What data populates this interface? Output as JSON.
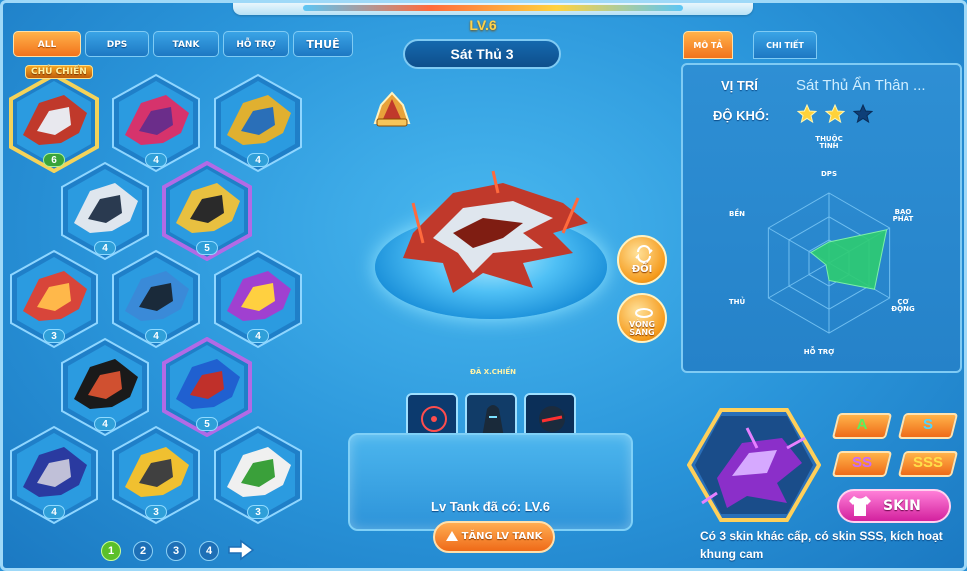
{
  "tabs": {
    "all": "ALL",
    "dps": "DPS",
    "tank": "TANK",
    "ho_tro": "HỖ TRỢ",
    "thue": "THUÊ"
  },
  "roster": {
    "main_tag": "CHỦ CHIẾN",
    "levels": [
      "6",
      "4",
      "4",
      "4",
      "5",
      "3",
      "4",
      "4",
      "4",
      "5",
      "4",
      "3",
      "3"
    ],
    "pages": [
      "1",
      "2",
      "3",
      "4"
    ]
  },
  "hero": {
    "level": "LV.6",
    "name": "Sát Thủ 3",
    "swap_label": "ĐỔI",
    "ring_label": "VÒNG\nSÁNG",
    "equipped_label": "ĐÃ X.CHIẾN",
    "tank_level_text": "Lv Tank đã có: LV.6",
    "upgrade_label": "TĂNG LV TANK"
  },
  "right_tabs": {
    "desc": "MÔ TẢ",
    "detail": "CHI TIẾT"
  },
  "stats": {
    "position_label": "VỊ TRÍ",
    "position_value": "Sát Thủ Ẩn Thân ...",
    "difficulty_label": "ĐỘ KHÓ:",
    "difficulty_stars": 2,
    "difficulty_max": 3,
    "radar_title": "THUỘC\nTÍNH",
    "axes": [
      "DPS",
      "BẠO\nPHÁT",
      "CƠ\nĐỘNG",
      "HỖ TRỢ",
      "THỦ",
      "BỀN"
    ],
    "radar_values": [
      0.3,
      0.95,
      0.75,
      0.25,
      0.05,
      0.3
    ]
  },
  "skins": {
    "grades": [
      "A",
      "S",
      "SS",
      "SSS"
    ],
    "button_label": "SKIN",
    "description": "Có 3 skin khác cấp, có skin SSS, kích hoạt khung cam"
  },
  "colors": {
    "accent_orange": "#f2731c",
    "panel_blue": "#2582c9",
    "radar_fill": "#2ecc71",
    "skin_pink": "#d3219e"
  }
}
